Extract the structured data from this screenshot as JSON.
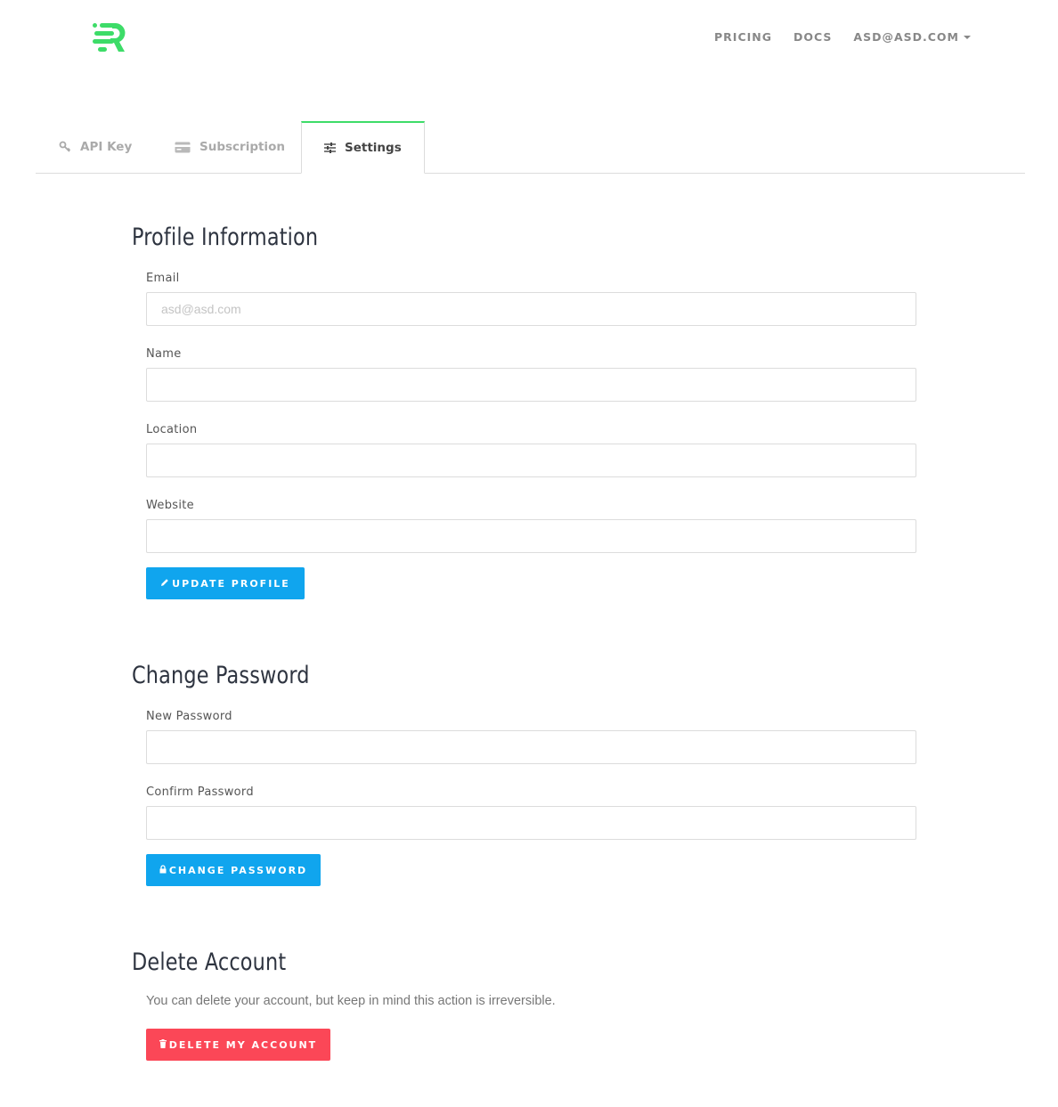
{
  "header": {
    "logo_name": "brand-logo",
    "nav": [
      {
        "label": "PRICING"
      },
      {
        "label": "DOCS"
      },
      {
        "label": "ASD@ASD.COM"
      }
    ]
  },
  "tabs": [
    {
      "label": "API Key",
      "icon": "key-icon"
    },
    {
      "label": "Subscription",
      "icon": "credit-card-icon"
    },
    {
      "label": "Settings",
      "icon": "sliders-icon",
      "active": true
    }
  ],
  "profile": {
    "title": "Profile Information",
    "email_label": "Email",
    "email_placeholder": "asd@asd.com",
    "name_label": "Name",
    "location_label": "Location",
    "website_label": "Website",
    "update_button": "UPDATE PROFILE"
  },
  "password": {
    "title": "Change Password",
    "new_label": "New Password",
    "confirm_label": "Confirm Password",
    "change_button": "CHANGE PASSWORD"
  },
  "delete": {
    "title": "Delete Account",
    "note": "You can delete your account, but keep in mind this action is irreversible.",
    "delete_button": "DELETE MY ACCOUNT"
  },
  "colors": {
    "accent_green": "#3ddc68",
    "button_blue": "#10a5ee",
    "button_red": "#fb4757"
  }
}
